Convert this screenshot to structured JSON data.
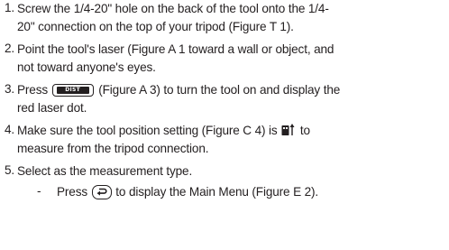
{
  "steps": [
    {
      "number": "1.",
      "line1": "Screw the 1/4-20\" hole on the back of the tool onto the 1/4-",
      "line2": "20\" connection on the top of your tripod (Figure T 1)."
    },
    {
      "number": "2.",
      "line1": "Point the tool's laser (Figure A 1  toward a wall or object, and",
      "line2": "not toward anyone's eyes."
    },
    {
      "number": "3.",
      "line1_before": "Press",
      "button_label": "DIST",
      "line1_after": "(Figure A 3) to turn the tool on and display the",
      "line2": "red laser dot."
    },
    {
      "number": "4.",
      "line1_before": "Make sure the tool position setting (Figure C 4) is",
      "line1_after": "to",
      "line2": "measure from the tripod connection."
    },
    {
      "number": "5.",
      "line1": "Select as the measurement type."
    }
  ],
  "substep": {
    "dash": "-",
    "before": "Press",
    "after": "to display the Main Menu (Figure E 2)."
  },
  "colors": {
    "text": "#231f20",
    "background": "#ffffff"
  },
  "icons": {
    "dist_button": "dist-button-icon",
    "tripod_position": "tripod-position-icon",
    "back_button": "back-arrow-button-icon"
  }
}
